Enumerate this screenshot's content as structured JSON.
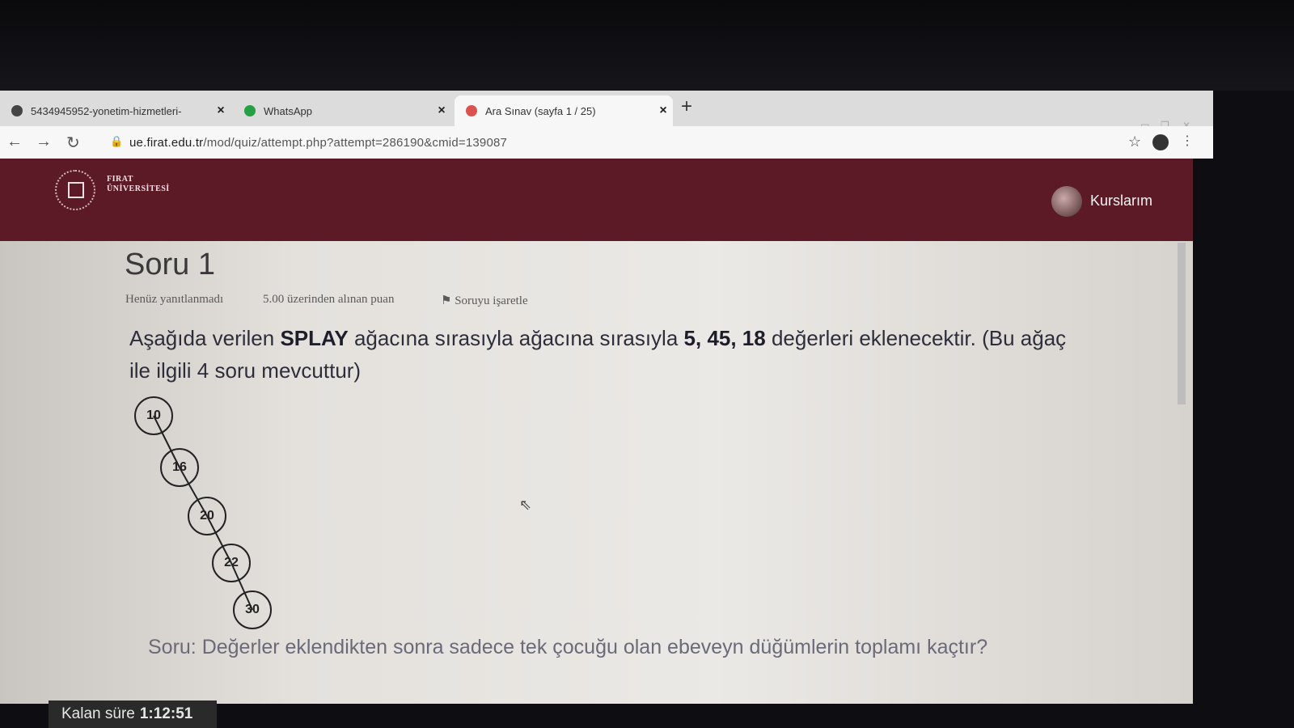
{
  "tabs": [
    {
      "title": "5434945952-yonetim-hizmetleri-",
      "close": "×"
    },
    {
      "title": "WhatsApp",
      "close": "×"
    },
    {
      "title": "Ara Sınav (sayfa 1 / 25)",
      "close": "×"
    }
  ],
  "new_tab": "+",
  "address": {
    "host": "ue.firat.edu.tr",
    "path": "/mod/quiz/attempt.php?attempt=286190&cmid=139087"
  },
  "site": {
    "uni_line1": "FIRAT",
    "uni_line2": "ÜNİVERSİTESİ",
    "courses_label": "Kurslarım"
  },
  "question": {
    "title": "Soru 1",
    "status": "Henüz yanıtlanmadı",
    "points": "5.00 üzerinden alınan puan",
    "flag_label": "Soruyu işaretle",
    "text_part1": "Aşağıda verilen ",
    "text_bold1": "SPLAY",
    "text_part2": " ağacına sırasıyla ağacına sırasıyla ",
    "text_bold2": "5, 45, 18",
    "text_part3": " değerleri eklenecektir. (Bu ağaç ile ilgili 4 soru mevcuttur)",
    "tree_nodes": [
      "10",
      "16",
      "20",
      "22",
      "30"
    ],
    "subquestion": "Soru: Değerler eklendikten sonra sadece tek çocuğu olan ebeveyn düğümlerin toplamı kaçtır?"
  },
  "timer": {
    "label": "Kalan süre",
    "value": "1:12:51"
  }
}
